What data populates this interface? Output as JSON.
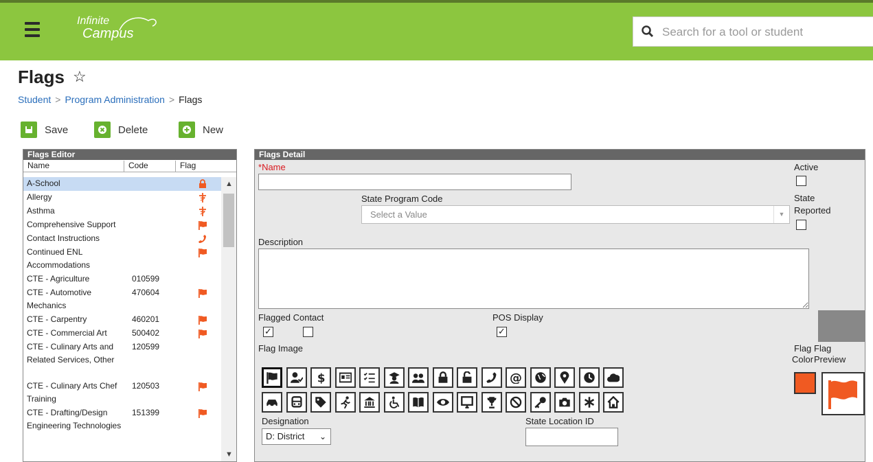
{
  "header": {
    "logo_line1": "Infinite",
    "logo_line2": "Campus",
    "search_placeholder": "Search for a tool or student",
    "brand_color": "#8cc63f"
  },
  "page": {
    "title": "Flags",
    "breadcrumbs": [
      "Student",
      "Program Administration",
      "Flags"
    ]
  },
  "toolbar": {
    "save": "Save",
    "delete": "Delete",
    "new": "New"
  },
  "editor": {
    "title": "Flags Editor",
    "columns": [
      "Name",
      "Code",
      "Flag"
    ],
    "rows": [
      {
        "name": "A-School",
        "code": "",
        "icon": "lock-icon",
        "selected": true
      },
      {
        "name": "Allergy",
        "code": "",
        "icon": "medical-icon"
      },
      {
        "name": "Asthma",
        "code": "",
        "icon": "medical-icon"
      },
      {
        "name": "Comprehensive Support",
        "code": "",
        "icon": "flag-icon"
      },
      {
        "name": "Contact Instructions",
        "code": "",
        "icon": "phone-icon"
      },
      {
        "name": "Continued ENL Accommodations",
        "code": "",
        "icon": "flag-icon"
      },
      {
        "name": "CTE - Agriculture",
        "code": "010599",
        "icon": ""
      },
      {
        "name": "CTE - Automotive Mechanics",
        "code": "470604",
        "icon": "flag-icon"
      },
      {
        "name": "CTE - Carpentry",
        "code": "460201",
        "icon": "flag-icon"
      },
      {
        "name": "CTE - Commercial Art",
        "code": "500402",
        "icon": "flag-icon"
      },
      {
        "name": "CTE - Culinary Arts and Related Services, Other",
        "code": "120599",
        "icon": ""
      },
      {
        "name": "CTE - Culinary Arts Chef Training",
        "code": "120503",
        "icon": "flag-icon"
      },
      {
        "name": "CTE - Drafting/Design Engineering Technologies",
        "code": "151399",
        "icon": "flag-icon"
      }
    ]
  },
  "detail": {
    "title": "Flags Detail",
    "name_required_marker": "*",
    "name_label": "Name",
    "active_label": "Active",
    "state_program_code_label": "State Program Code",
    "state_program_code_placeholder": "Select a Value",
    "state_reported_label_1": "State",
    "state_reported_label_2": "Reported",
    "description_label": "Description",
    "flagged_contact_label": "Flagged Contact",
    "pos_display_label": "POS Display",
    "flag_image_label": "Flag Image",
    "flag_color_label_1": "Flag",
    "flag_color_label_2": "Color",
    "flag_preview_label_1": "Flag",
    "flag_preview_label_2": "Preview",
    "designation_label": "Designation",
    "designation_value": "D: District",
    "state_location_id_label": "State Location ID",
    "flag_color": "#f05a22",
    "icons_row1": [
      "flag-icon",
      "user-check-icon",
      "dollar-icon",
      "id-card-icon",
      "checklist-icon",
      "graduate-icon",
      "group-icon",
      "lock-icon",
      "unlock-icon",
      "phone-icon",
      "at-icon",
      "globe-icon",
      "map-pin-icon",
      "clock-icon",
      "cloud-icon"
    ],
    "icons_row2": [
      "car-icon",
      "bus-icon",
      "tag-icon",
      "running-icon",
      "bank-icon",
      "wheelchair-icon",
      "book-icon",
      "eye-icon",
      "monitor-icon",
      "trophy-icon",
      "ban-icon",
      "key-icon",
      "camera-icon",
      "asterisk-icon",
      "home-icon"
    ]
  }
}
